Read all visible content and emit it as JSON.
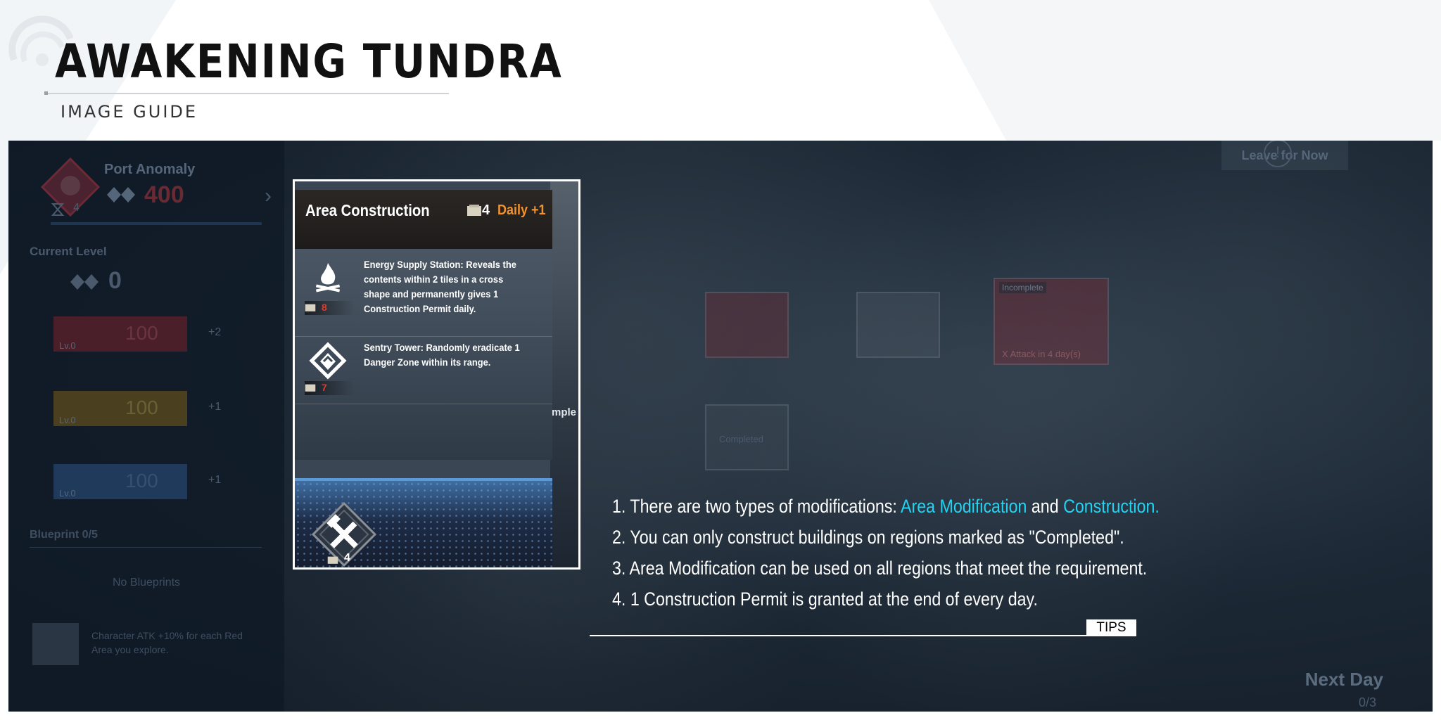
{
  "header": {
    "title": "AWAKENING TUNDRA",
    "subtitle": "IMAGE GUIDE"
  },
  "game_bg": {
    "anomaly_title": "Port Anomaly",
    "anomaly_value": "400",
    "timer_value": "4",
    "current_level_label": "Current Level",
    "current_level_value": "0",
    "stats": [
      {
        "lv": "Lv.0",
        "value": "100",
        "delta": "+2",
        "color": "#7a1f2a"
      },
      {
        "lv": "Lv.0",
        "value": "100",
        "delta": "+1",
        "color": "#7a6020"
      },
      {
        "lv": "Lv.0",
        "value": "100",
        "delta": "+1",
        "color": "#234f7a"
      }
    ],
    "blueprint_label": "Blueprint 0/5",
    "no_blueprints": "No Blueprints",
    "character_bonus": "Character ATK +10% for each Red Area you explore.",
    "leave_btn": "Leave for Now",
    "next_day": "Next Day",
    "next_day_count": "0/3",
    "tile_labels": {
      "incomplete": "Incomplete",
      "attack": "X Attack in 4 day(s)",
      "completed": "Completed"
    }
  },
  "card": {
    "title": "Area Construction",
    "permit_count": "4",
    "daily": "Daily +1",
    "items": [
      {
        "icon": "campfire-icon",
        "cost": "8",
        "text": "Energy Supply Station: Reveals the contents within 2 tiles in a cross shape and permanently gives 1 Construction Permit daily."
      },
      {
        "icon": "sentry-tower-icon",
        "cost": "7",
        "text": "Sentry Tower: Randomly eradicate 1 Danger Zone within its range."
      }
    ],
    "footer_count": "4",
    "side_label": "mple"
  },
  "tips": {
    "line1_prefix": "1. There are two types of modifications: ",
    "line1_h1": "Area Modification",
    "line1_mid": " and ",
    "line1_h2": "Construction.",
    "line2": "2. You can only construct buildings on regions marked as \"Completed\".",
    "line3": "3. Area Modification can be used on all regions that meet the requirement.",
    "line4": "4. 1 Construction Permit is granted at the end of every day.",
    "tag": "TIPS"
  },
  "colors": {
    "highlight": "#22d3f2",
    "daily": "#f2922c",
    "cost": "#e23a2a"
  }
}
